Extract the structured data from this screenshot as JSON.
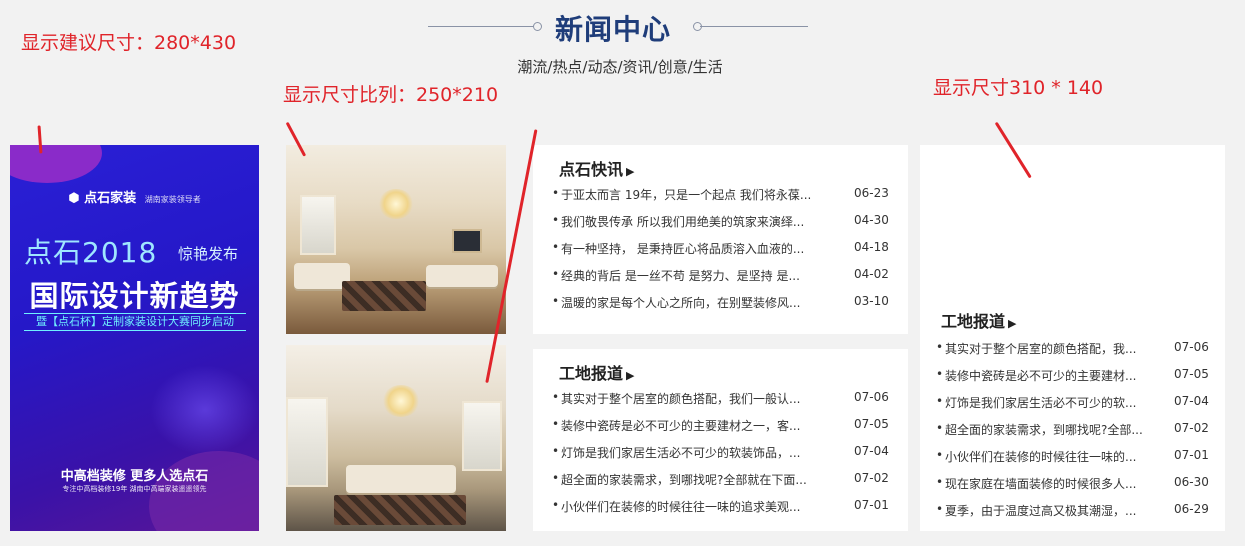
{
  "header": {
    "title": "新闻中心",
    "subtitle": "潮流/热点/动态/资讯/创意/生活"
  },
  "annotations": [
    "显示建议尺寸：280*430",
    "显示尺寸比列：250*210",
    "显示尺寸310 * 140"
  ],
  "banner": {
    "brand": "点石家装",
    "brand_sub": "湖南家装领导者",
    "headline_1": "点石2018",
    "headline_1_suffix": "惊艳发布",
    "headline_2": "国际设计新趋势",
    "strip": "暨【点石杯】定制家装设计大赛同步启动",
    "footer_1": "中高档装修  更多人选点石",
    "footer_2": "专注中高档装修19年   湖南中高端家装遥遥领先"
  },
  "news_flash": {
    "title": "点石快讯",
    "items": [
      {
        "text": "于亚太而言 19年，只是一个起点 我们将永葆...",
        "date": "06-23"
      },
      {
        "text": "我们敬畏传承 所以我们用绝美的筑家来演绎...",
        "date": "04-30"
      },
      {
        "text": "有一种坚持， 是秉持匠心将品质溶入血液的...",
        "date": "04-18"
      },
      {
        "text": "经典的背后 是一丝不苟 是努力、是坚持 是...",
        "date": "04-02"
      },
      {
        "text": "温暖的家是每个人心之所向，在别墅装修风...",
        "date": "03-10"
      }
    ]
  },
  "site_report_middle": {
    "title": "工地报道",
    "items": [
      {
        "text": "其实对于整个居室的颜色搭配，我们一般认...",
        "date": "07-06"
      },
      {
        "text": "装修中瓷砖是必不可少的主要建材之一，客...",
        "date": "07-05"
      },
      {
        "text": "灯饰是我们家居生活必不可少的软装饰品，...",
        "date": "07-04"
      },
      {
        "text": "超全面的家装需求，到哪找呢?全部就在下面...",
        "date": "07-02"
      },
      {
        "text": "小伙伴们在装修的时候往往一味的追求美观...",
        "date": "07-01"
      }
    ]
  },
  "site_report_right": {
    "title": "工地报道",
    "items": [
      {
        "text": "其实对于整个居室的颜色搭配，我...",
        "date": "07-06"
      },
      {
        "text": "装修中瓷砖是必不可少的主要建材...",
        "date": "07-05"
      },
      {
        "text": "灯饰是我们家居生活必不可少的软...",
        "date": "07-04"
      },
      {
        "text": "超全面的家装需求，到哪找呢?全部...",
        "date": "07-02"
      },
      {
        "text": "小伙伴们在装修的时候往往一味的...",
        "date": "07-01"
      },
      {
        "text": "现在家庭在墙面装修的时候很多人...",
        "date": "06-30"
      },
      {
        "text": "夏季，由于温度过高又极其潮湿，...",
        "date": "06-29"
      }
    ]
  },
  "colors": {
    "background": "#f2f2f2",
    "title_blue": "#1f3d7a",
    "annotation_red": "#e0242a",
    "banner_blue": "#2a20d6"
  }
}
